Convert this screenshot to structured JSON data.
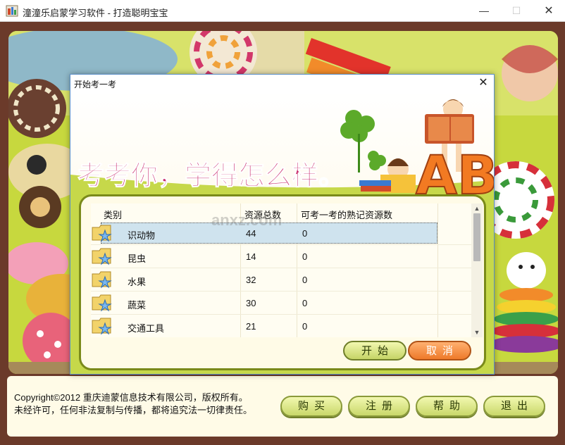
{
  "window": {
    "title": "潼潼乐启蒙学习软件 - 打造聪明宝宝",
    "minimize": "—",
    "maximize": "☐",
    "close": "✕"
  },
  "footer": {
    "copyright_line1": "Copyright©2012 重庆迪蒙信息技术有限公司，版权所有。",
    "copyright_line2": "未经许可，任何非法复制与传播，都将追究法一切律责任。",
    "buttons": [
      "购买",
      "注册",
      "帮助",
      "退出"
    ]
  },
  "dialog": {
    "title": "开始考一考",
    "close": "✕",
    "banner_text": "考考你，学得怎么样。",
    "banner_letters": "AB",
    "columns": [
      "类别",
      "资源总数",
      "可考一考的熟记资源数"
    ],
    "rows": [
      {
        "category": "识动物",
        "total": "44",
        "ready": "0",
        "selected": true
      },
      {
        "category": "昆虫",
        "total": "14",
        "ready": "0",
        "selected": false
      },
      {
        "category": "水果",
        "total": "32",
        "ready": "0",
        "selected": false
      },
      {
        "category": "蔬菜",
        "total": "30",
        "ready": "0",
        "selected": false
      },
      {
        "category": "交通工具",
        "total": "21",
        "ready": "0",
        "selected": false
      }
    ],
    "scroll_up": "▲",
    "scroll_down": "▼",
    "start_label": "开始",
    "cancel_label": "取消"
  },
  "watermark": "anxz.com",
  "colors": {
    "frame": "#6b3a2a",
    "panel_border": "#7a8a1a",
    "start_button": "#c5d466",
    "cancel_button": "#ee7a2a",
    "selected_row": "#cfe3ee"
  }
}
